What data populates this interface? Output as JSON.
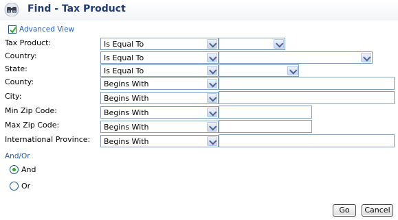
{
  "header": {
    "title": "Find - Tax Product",
    "icon": "binoculars-icon"
  },
  "advanced_view": {
    "label": "Advanced View",
    "checked": true
  },
  "fields": [
    {
      "label": "Tax Product:",
      "operator": "Is Equal To",
      "value": ""
    },
    {
      "label": "Country:",
      "operator": "Is Equal To",
      "value": ""
    },
    {
      "label": "State:",
      "operator": "Is Equal To",
      "value": ""
    },
    {
      "label": "County:",
      "operator": "Begins With",
      "value": ""
    },
    {
      "label": "City:",
      "operator": "Begins With",
      "value": ""
    },
    {
      "label": "Min Zip Code:",
      "operator": "Begins With",
      "value": ""
    },
    {
      "label": "Max Zip Code:",
      "operator": "Begins With",
      "value": ""
    },
    {
      "label": "International Province:",
      "operator": "Begins With",
      "value": ""
    }
  ],
  "andor": {
    "label": "And/Or",
    "options": [
      {
        "label": "And",
        "selected": true
      },
      {
        "label": "Or",
        "selected": false
      }
    ]
  },
  "buttons": {
    "go": "Go",
    "cancel": "Cancel"
  },
  "colors": {
    "title": "#1f3d73",
    "link": "#2a5db0",
    "input_border": "#7f9db9"
  }
}
